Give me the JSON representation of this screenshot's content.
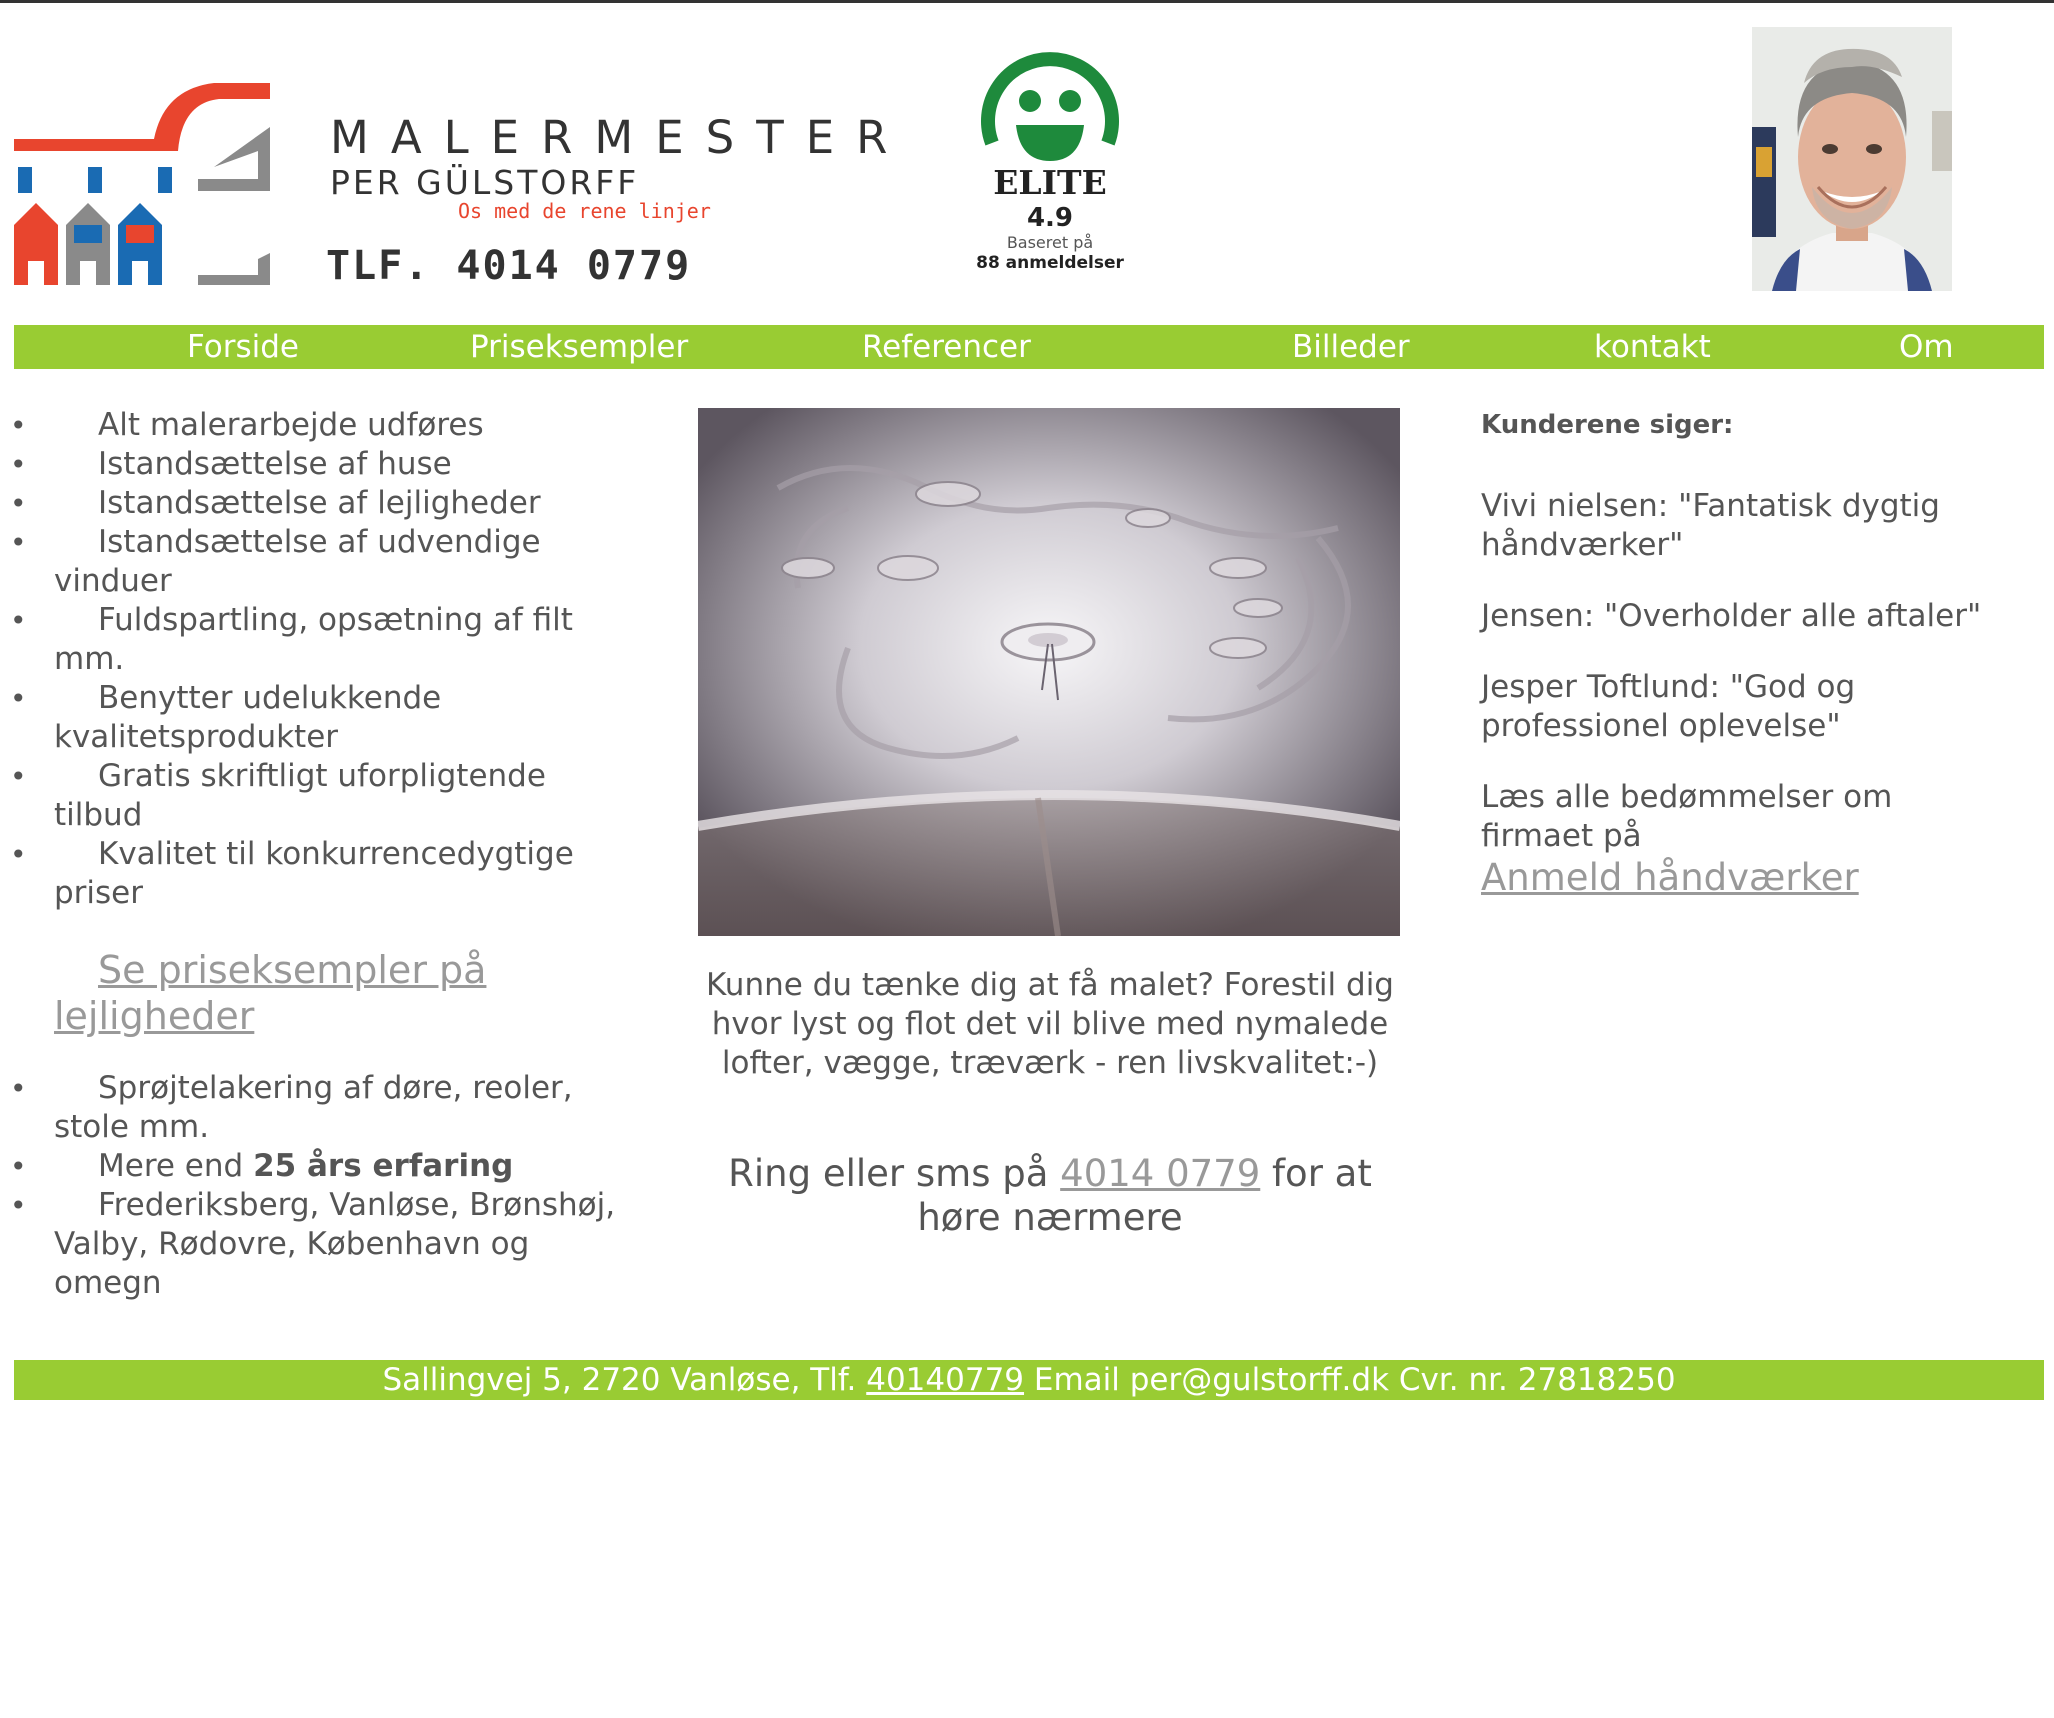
{
  "header": {
    "brand_name": "MALERMESTER",
    "owner": "PER GÜLSTORFF",
    "slogan": "Os med de rene linjer",
    "phone": "TLF. 4014 0779",
    "elite_badge": {
      "title": "ELITE",
      "score": "4.9",
      "based_on": "Baseret på",
      "count": "88 anmeldelser"
    },
    "brand_colors": {
      "red": "#e8452e",
      "blue": "#1a6bb3",
      "gray": "#8a8a8a",
      "green": "#1e8a3c"
    }
  },
  "nav": {
    "items": [
      {
        "label": "Forside"
      },
      {
        "label": "Priseksempler"
      },
      {
        "label": "Referencer"
      },
      {
        "label": "Billeder"
      },
      {
        "label": "kontakt"
      },
      {
        "label": "Om"
      }
    ],
    "background": "#99cc33"
  },
  "left": {
    "services": [
      "Alt malerarbejde udføres",
      "Istandsættelse af huse",
      "Istandsættelse af lejligheder",
      "Istandsættelse af udvendige vinduer",
      "Fuldspartling, opsætning af filt mm.",
      "Benytter udelukkende kvalitetsprodukter",
      "Gratis skriftligt uforpligtende tilbud",
      "Kvalitet til konkurrencedygtige priser"
    ],
    "price_link": "Se priseksempler på lejligheder",
    "extra": {
      "spray": "Sprøjtelakering af døre, reoler, stole mm.",
      "experience_prefix": "Mere end",
      "experience_bold": "25 års erfaring",
      "areas": "Frederiksberg, Vanløse, Brønshøj, Valby, Rødovre, København og omegn"
    }
  },
  "center": {
    "pitch": "Kunne du tænke dig at få malet? Forestil dig hvor lyst og flot det vil blive med nymalede lofter, vægge, træværk - ren livskvalitet:-)",
    "call_prefix": "Ring eller sms på",
    "call_number": "4014 0779",
    "call_suffix": "for at høre nærmere"
  },
  "right": {
    "heading": "Kunderene siger:",
    "reviews": [
      "Vivi nielsen: \"Fantatisk dygtig håndværker\"",
      "Jensen: \"Overholder alle aftaler\"",
      "Jesper Toftlund: \"God og professionel oplevelse\""
    ],
    "read_all": "Læs alle bedømmelser om firmaet på",
    "review_site": "Anmeld håndværker"
  },
  "footer": {
    "address": "Sallingvej 5, 2720 Vanløse, Tlf.",
    "phone": "40140779",
    "rest": "Email per@gulstorff.dk Cvr. nr. 27818250"
  }
}
